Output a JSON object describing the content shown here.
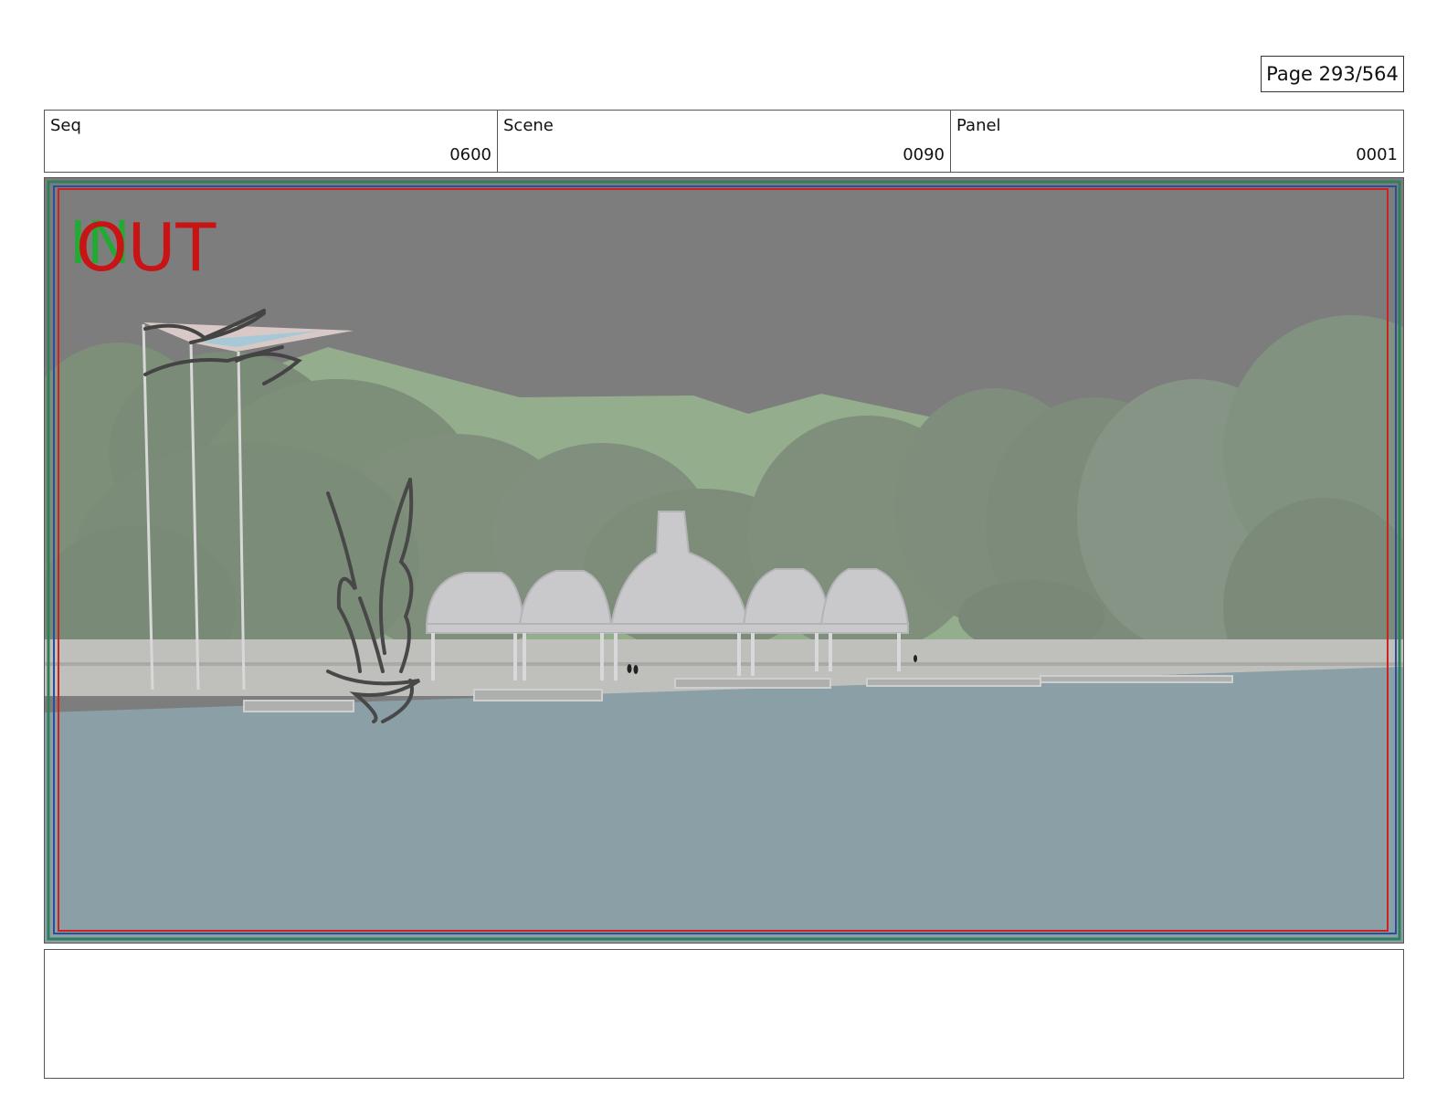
{
  "page_label": "Page 293/564",
  "header": {
    "seq": {
      "label": "Seq",
      "value": "0600"
    },
    "scene": {
      "label": "Scene",
      "value": "0090"
    },
    "panel": {
      "label": "Panel",
      "value": "0001"
    }
  },
  "panel_image": {
    "in_marker": "IN",
    "out_marker": "OUT",
    "colors": {
      "sky": "#7d7d7d",
      "hills_far": "#92ad8c",
      "trees": "#7f917b",
      "water": "#8a9fa6",
      "pavilions": "#c9c9cc",
      "in_marker": "#22aa33",
      "out_marker": "#c81414",
      "safe_frame": "#cc2222",
      "outer_frame": "#2f7f5a"
    }
  },
  "notes_text": ""
}
